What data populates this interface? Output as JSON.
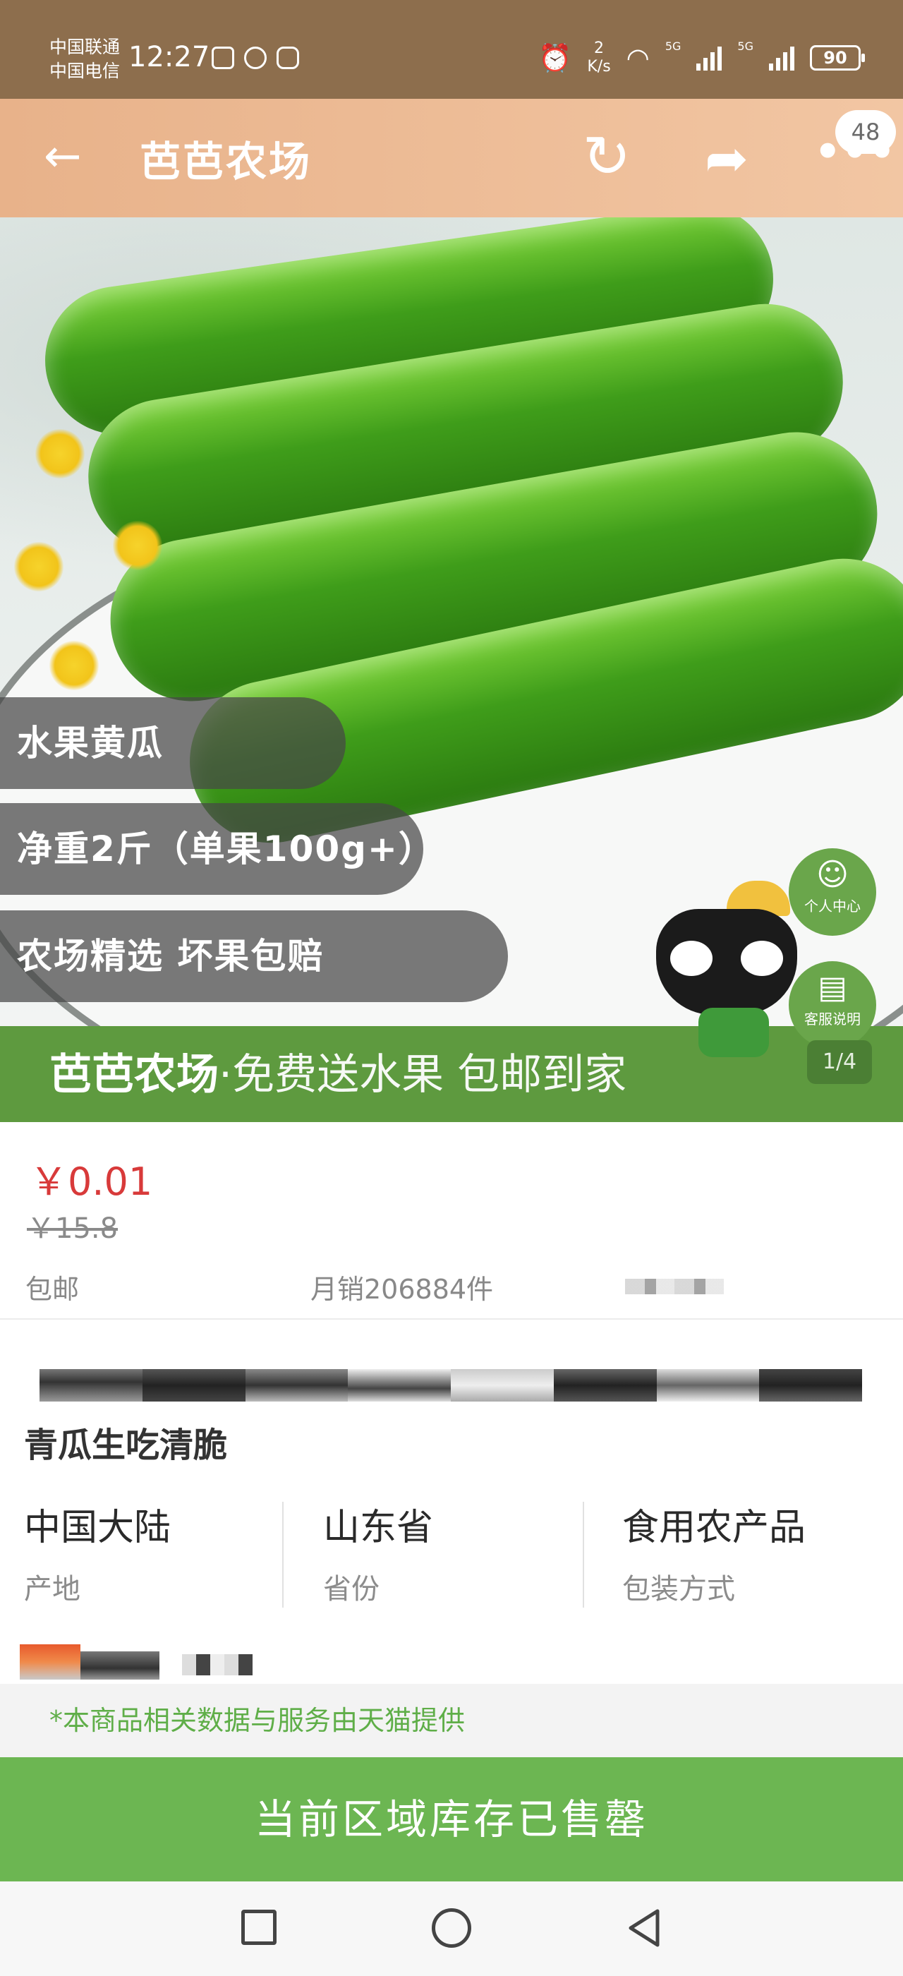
{
  "status_bar": {
    "carrier_1": "中国联通",
    "carrier_2": "中国电信",
    "time": "12:27",
    "net_speed_value": "2",
    "net_speed_unit": "K/s",
    "signal_1": "5G",
    "signal_2": "5G",
    "battery": "90"
  },
  "header": {
    "title": "芭芭农场",
    "back_icon": "back-arrow-icon",
    "refresh_icon": "refresh-icon",
    "share_icon": "share-icon",
    "more_icon": "more-dots-icon",
    "message_count": "48",
    "background_color": "#e8b28a"
  },
  "hero": {
    "tags": [
      "水果黄瓜",
      "净重2斤（单果100g+）",
      "农场精选 坏果包赔"
    ],
    "band_brand": "芭芭农场",
    "band_slogan": "·免费送水果  包邮到家",
    "side_buttons": [
      {
        "icon": "person-icon",
        "label": "个人中心"
      },
      {
        "icon": "document-icon",
        "label": "客服说明"
      }
    ],
    "page_indicator": "1/4"
  },
  "price": {
    "current": "￥0.01",
    "original": "￥15.8",
    "shipping": "包邮",
    "monthly_sales": "月销206884件",
    "price_color": "#d83a3a"
  },
  "product": {
    "subtitle": "青瓜生吃清脆",
    "specs": [
      {
        "value": "中国大陆",
        "key": "产地"
      },
      {
        "value": "山东省",
        "key": "省份"
      },
      {
        "value": "食用农产品",
        "key": "包装方式"
      }
    ]
  },
  "notice": "*本商品相关数据与服务由天猫提供",
  "buy_button": {
    "label": "当前区域库存已售罄",
    "color": "#6cb652"
  },
  "nav": {
    "recent_icon": "square-icon",
    "home_icon": "circle-icon",
    "back_icon": "triangle-back-icon"
  }
}
